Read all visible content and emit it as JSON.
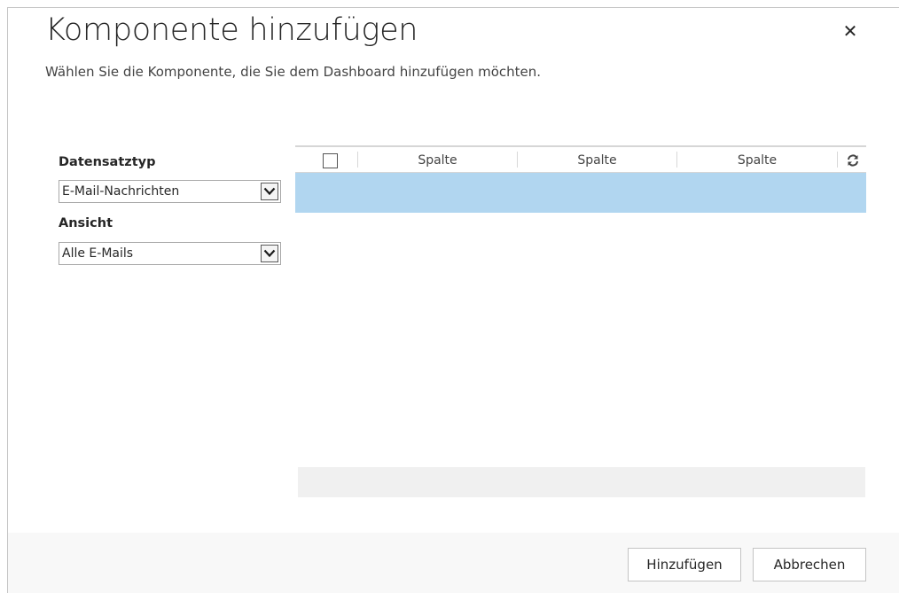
{
  "dialog": {
    "title": "Komponente hinzufügen",
    "subtitle": "Wählen Sie die Komponente, die Sie dem Dashboard hinzufügen möchten.",
    "close_icon": "close-icon"
  },
  "form": {
    "record_type_label": "Datensatztyp",
    "record_type_value": "E-Mail-Nachrichten",
    "view_label": "Ansicht",
    "view_value": "Alle E-Mails",
    "dropdown_icon": "chevron-down-icon"
  },
  "grid": {
    "columns": [
      "Spalte",
      "Spalte",
      "Spalte"
    ],
    "refresh_icon": "refresh-icon",
    "selected_row_color": "#b1d6f0"
  },
  "buttons": {
    "add_label": "Hinzufügen",
    "cancel_label": "Abbrechen"
  }
}
